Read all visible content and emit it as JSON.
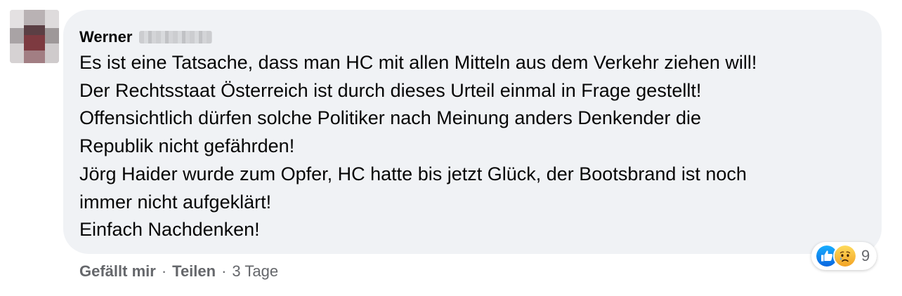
{
  "comment": {
    "author_name": "Werner",
    "lines": [
      "Es ist eine Tatsache, dass man HC mit allen Mitteln aus dem Verkehr ziehen will!",
      "Der Rechtsstaat Österreich ist durch dieses Urteil einmal in Frage gestellt!",
      "Offensichtlich dürfen solche Politiker nach Meinung anders Denkender die",
      "Republik nicht gefährden!",
      "Jörg Haider wurde zum Opfer, HC hatte bis jetzt Glück, der Bootsbrand ist noch",
      "immer nicht aufgeklärt!",
      "Einfach Nachdenken!"
    ],
    "reactions": {
      "icons": [
        "like-icon",
        "sad-icon"
      ],
      "count": "9"
    },
    "actions": {
      "like_label": "Gefällt mir",
      "share_label": "Teilen",
      "separator": "·",
      "timestamp": "3 Tage"
    }
  },
  "colors": {
    "bubble": "#f0f2f5",
    "text": "#050505",
    "secondary_text": "#65676b",
    "like_blue": "#1877f2",
    "sad_yellow": "#f7b125"
  }
}
